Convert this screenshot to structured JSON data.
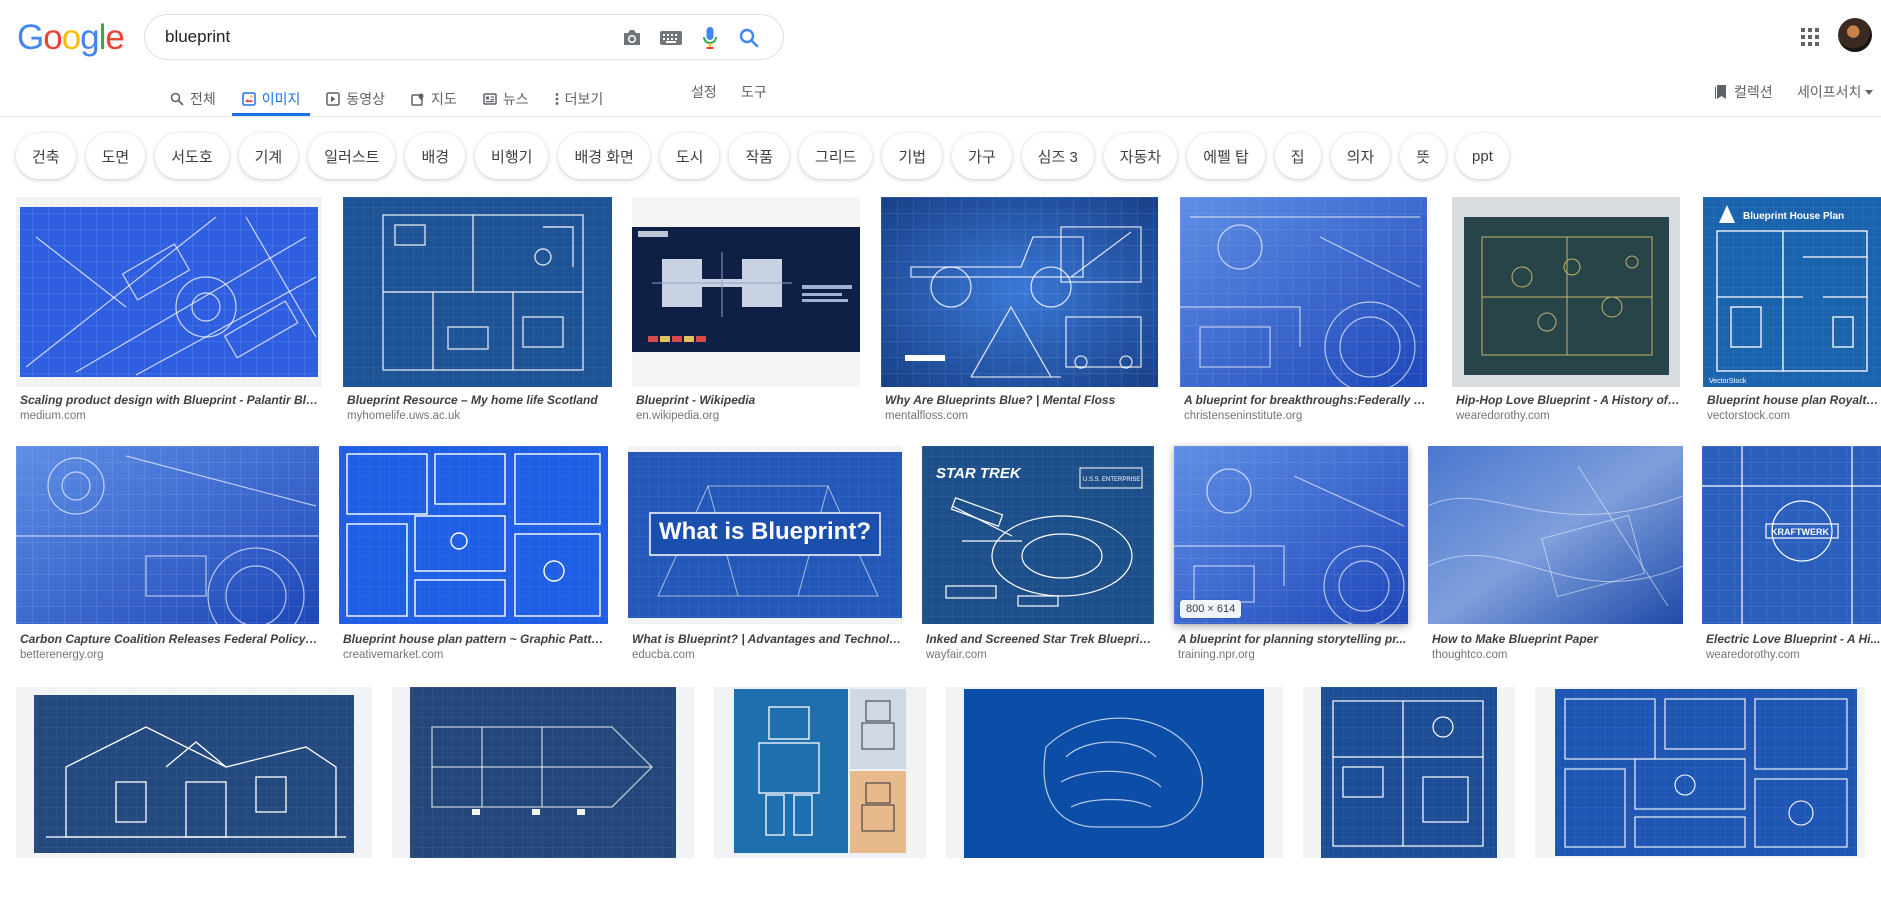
{
  "logo": "Google",
  "search": {
    "query": "blueprint"
  },
  "icons": {
    "camera": "camera-icon",
    "keyboard": "keyboard-icon",
    "mic": "microphone-icon",
    "search": "search-icon",
    "apps": "apps-grid-icon"
  },
  "tabs": [
    {
      "label": "전체",
      "icon": "search-icon"
    },
    {
      "label": "이미지",
      "icon": "image-icon",
      "active": true
    },
    {
      "label": "동영상",
      "icon": "video-icon"
    },
    {
      "label": "지도",
      "icon": "map-icon"
    },
    {
      "label": "뉴스",
      "icon": "news-icon"
    },
    {
      "label": "더보기",
      "icon": "more-vert-icon"
    }
  ],
  "tools": {
    "settings": "설정",
    "tools": "도구"
  },
  "right_nav": {
    "collections": "컬렉션",
    "safesearch": "세이프서치"
  },
  "chips": [
    "건축",
    "도면",
    "서도호",
    "기계",
    "일러스트",
    "배경",
    "비행기",
    "배경 화면",
    "도시",
    "작품",
    "그리드",
    "기법",
    "가구",
    "심즈 3",
    "자동차",
    "에펠 탑",
    "집",
    "의자",
    "뜻",
    "ppt"
  ],
  "thumb_overlay": "What is Blueprint?",
  "thumb_texts": {
    "star_trek": "STAR TREK",
    "uss": "U.S.S. ENTERPRISE",
    "kraftwerk": "KRAFTWERK",
    "house_plan": "Blueprint House Plan",
    "vectorstock": "VectorStock"
  },
  "row1": [
    {
      "title": "Scaling product design with Blueprint - Palantir Blo...",
      "source": "medium.com"
    },
    {
      "title": "Blueprint Resource – My home life Scotland",
      "source": "myhomelife.uws.ac.uk"
    },
    {
      "title": "Blueprint - Wikipedia",
      "source": "en.wikipedia.org"
    },
    {
      "title": "Why Are Blueprints Blue? | Mental Floss",
      "source": "mentalfloss.com"
    },
    {
      "title": "A blueprint for breakthroughs:Federally f...",
      "source": "christenseninstitute.org"
    },
    {
      "title": "Hip-Hop Love Blueprint - A History of ...",
      "source": "wearedorothy.com"
    },
    {
      "title": "Blueprint house plan Royalty ...",
      "source": "vectorstock.com"
    }
  ],
  "row2": [
    {
      "title": "Carbon Capture Coalition Releases Federal Policy B...",
      "source": "betterenergy.org"
    },
    {
      "title": "Blueprint house plan pattern ~ Graphic Patter...",
      "source": "creativemarket.com"
    },
    {
      "title": "What is Blueprint? | Advantages and Technolo...",
      "source": "educba.com"
    },
    {
      "title": "Inked and Screened Star Trek Blueprin...",
      "source": "wayfair.com"
    },
    {
      "title": "A blueprint for planning storytelling pr...",
      "source": "training.npr.org",
      "dims": "800 × 614"
    },
    {
      "title": "How to Make Blueprint Paper",
      "source": "thoughtco.com"
    },
    {
      "title": "Electric Love Blueprint - A Hi...",
      "source": "wearedorothy.com"
    }
  ],
  "colors": {
    "accent": "#1a73e8",
    "blueprint_dark": "#1d4f8f",
    "blueprint_bright": "#1f5fe0"
  }
}
